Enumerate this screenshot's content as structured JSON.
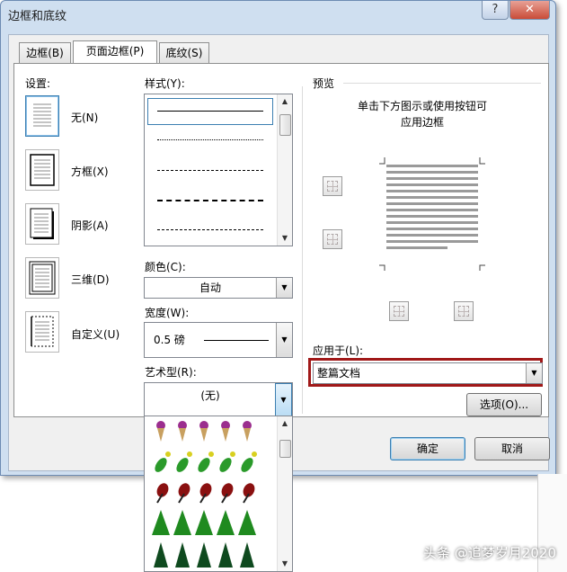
{
  "window": {
    "title": "边框和底纹",
    "help": "?",
    "close": "✕"
  },
  "tabs": [
    {
      "label": "边框(B)"
    },
    {
      "label": "页面边框(P)"
    },
    {
      "label": "底纹(S)"
    }
  ],
  "settings": {
    "heading": "设置:",
    "items": [
      {
        "label": "无(N)"
      },
      {
        "label": "方框(X)"
      },
      {
        "label": "阴影(A)"
      },
      {
        "label": "三维(D)"
      },
      {
        "label": "自定义(U)"
      }
    ]
  },
  "style": {
    "heading": "样式(Y):"
  },
  "color": {
    "heading": "颜色(C):",
    "value": "自动"
  },
  "width": {
    "heading": "宽度(W):",
    "value": "0.5 磅"
  },
  "art": {
    "heading": "艺术型(R):",
    "value": "(无)"
  },
  "preview": {
    "heading": "预览",
    "hint_line1": "单击下方图示或使用按钮可",
    "hint_line2": "应用边框"
  },
  "apply": {
    "heading": "应用于(L):",
    "value": "整篇文档",
    "highlight_color": "#a01818"
  },
  "buttons": {
    "options": "选项(O)...",
    "ok": "确定",
    "cancel": "取消"
  },
  "watermark": "头条 @追梦岁月2020"
}
